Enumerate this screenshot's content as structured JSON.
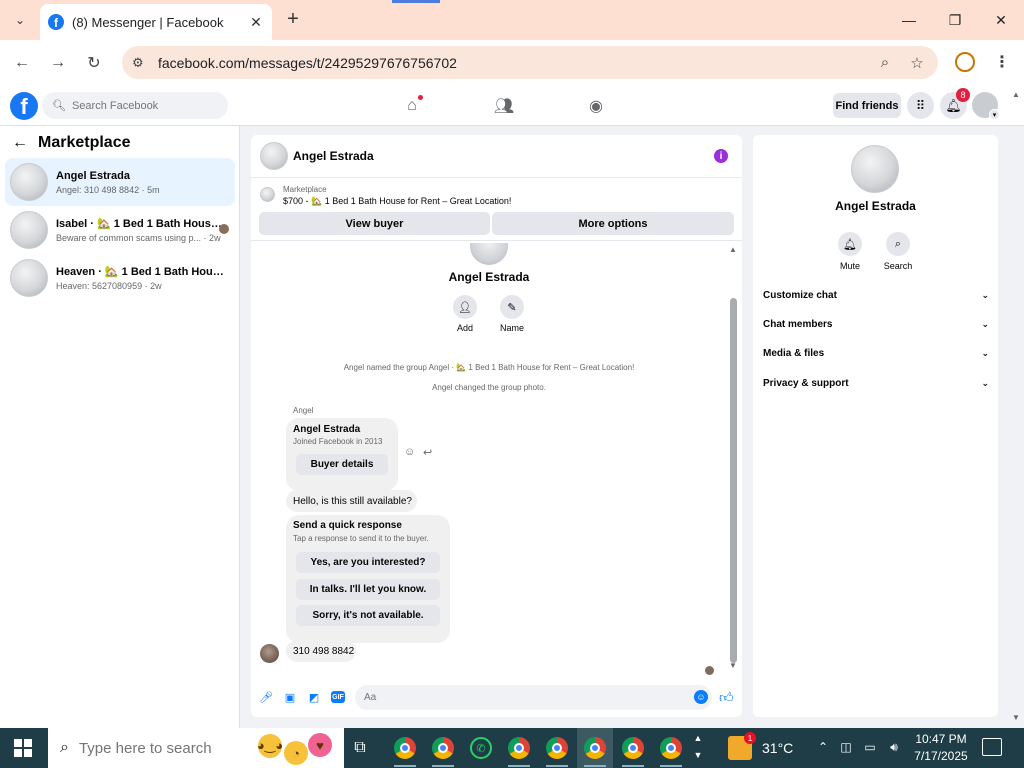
{
  "browser": {
    "tab_title": "(8) Messenger | Facebook",
    "tab_favicon": "f",
    "url": "facebook.com/messages/t/24295297676756702"
  },
  "fb_header": {
    "logo": "f",
    "search_placeholder": "Search Facebook",
    "find_friends": "Find friends",
    "notification_count": "8"
  },
  "left_panel": {
    "title": "Marketplace",
    "conversations": [
      {
        "name": "Angel Estrada",
        "preview": "Angel: 310 498 8842 · 5m"
      },
      {
        "name": "Isabel · 🏡 1 Bed 1 Bath House f...",
        "preview": "Beware of common scams using p... · 2w"
      },
      {
        "name": "Heaven · 🏡 1 Bed 1 Bath House fo...",
        "preview": "Heaven: 5627080959 · 2w"
      }
    ]
  },
  "chat": {
    "header_name": "Angel Estrada",
    "marketplace_label": "Marketplace",
    "listing": "$700 - 🏡 1 Bed 1 Bath House for Rent – Great Location!",
    "view_buyer": "View buyer",
    "more_options": "More options",
    "group_name": "Angel Estrada",
    "add_label": "Add",
    "name_label": "Name",
    "system_messages": [
      "Angel named the group Angel · 🏡 1 Bed 1 Bath House for Rent – Great Location!",
      "Angel changed the group photo."
    ],
    "sender_label": "Angel",
    "profile_card": {
      "name": "Angel Estrada",
      "subtitle": "Joined Facebook in 2013",
      "button": "Buyer details"
    },
    "message_1": "Hello, is this still available?",
    "quick_response": {
      "title": "Send a quick response",
      "subtitle": "Tap a response to send it to the buyer.",
      "options": [
        "Yes, are you interested?",
        "In talks. I'll let you know.",
        "Sorry, it's not available."
      ]
    },
    "message_2": "310 498 8842",
    "composer_placeholder": "Aa",
    "gif_label": "GIF"
  },
  "right_panel": {
    "name": "Angel Estrada",
    "mute": "Mute",
    "search": "Search",
    "sections": [
      "Customize chat",
      "Chat members",
      "Media & files",
      "Privacy & support"
    ]
  },
  "taskbar": {
    "search_placeholder": "Type here to search",
    "temperature": "31°C",
    "weather_badge": "1",
    "time": "10:47 PM",
    "date": "7/17/2025"
  },
  "colors": {
    "facebook_blue": "#1877f2",
    "messenger_blue": "#0a7cff",
    "info_purple": "#9b30d9",
    "notification_red": "#e41e3f",
    "chrome_tabbar": "#fde0d2",
    "taskbar": "#1f3d46"
  }
}
